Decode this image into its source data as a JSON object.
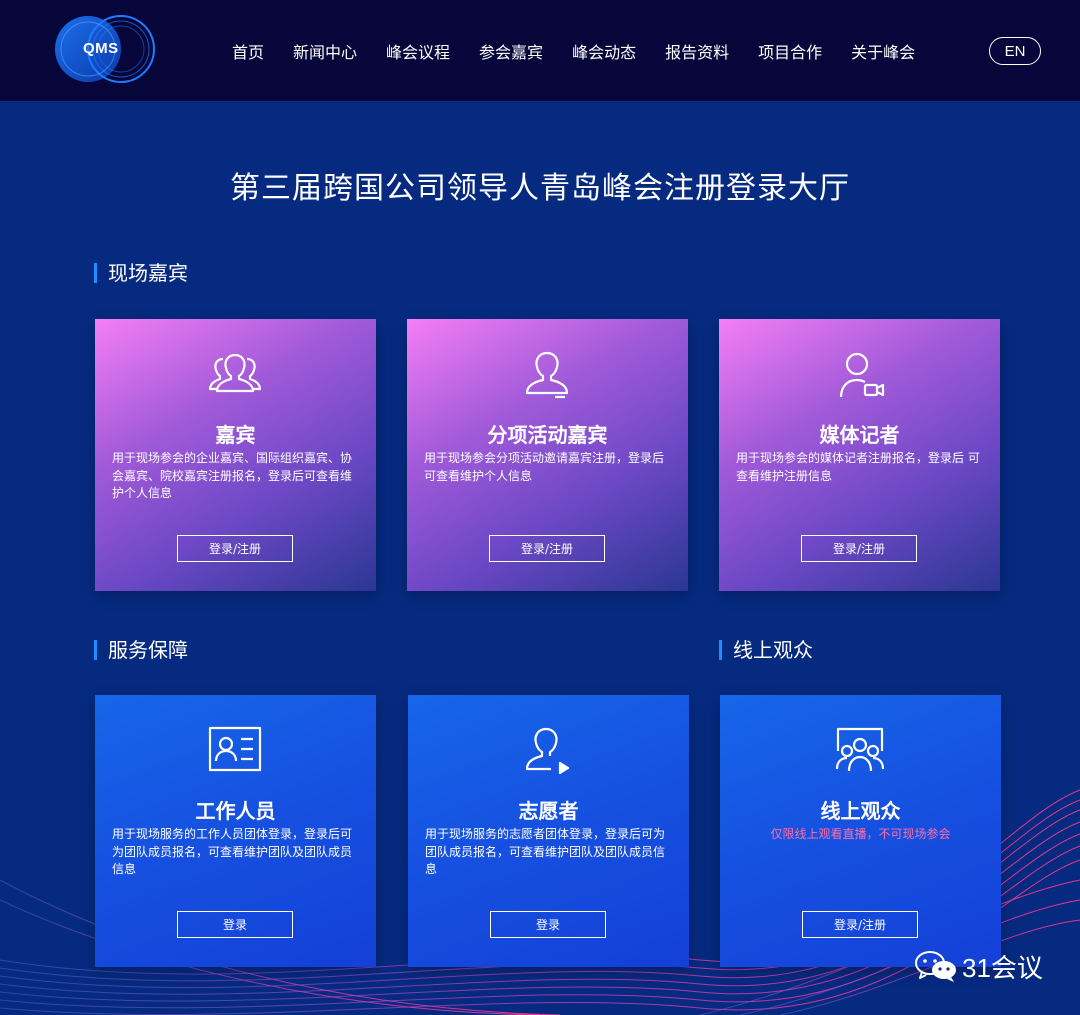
{
  "header": {
    "logo_text": "QMS",
    "nav": [
      "首页",
      "新闻中心",
      "峰会议程",
      "参会嘉宾",
      "峰会动态",
      "报告资料",
      "项目合作",
      "关于峰会"
    ],
    "lang_label": "EN"
  },
  "page_title": "第三届跨国公司领导人青岛峰会注册登录大厅",
  "sections": {
    "onsite": "现场嘉宾",
    "service": "服务保障",
    "online": "线上观众"
  },
  "cards": {
    "guest": {
      "title": "嘉宾",
      "desc": "用于现场参会的企业嘉宾、国际组织嘉宾、协会嘉宾、院校嘉宾注册报名，登录后可查看维护个人信息",
      "button": "登录/注册",
      "icon": "group-users-icon"
    },
    "sub_guest": {
      "title": "分项活动嘉宾",
      "desc": "用于现场参会分项活动邀请嘉宾注册，登录后可查看维护个人信息",
      "button": "登录/注册",
      "icon": "user-icon"
    },
    "media": {
      "title": "媒体记者",
      "desc": "用于现场参会的媒体记者注册报名，登录后 可查看维护注册信息",
      "button": "登录/注册",
      "icon": "user-camera-icon"
    },
    "staff": {
      "title": "工作人员",
      "desc": "用于现场服务的工作人员团体登录，登录后可为团队成员报名，可查看维护团队及团队成员信息",
      "button": "登录",
      "icon": "id-card-icon"
    },
    "volunteer": {
      "title": "志愿者",
      "desc": "用于现场服务的志愿者团体登录，登录后可为团队成员报名，可查看维护团队及团队成员信息",
      "button": "登录",
      "icon": "user-play-icon"
    },
    "online": {
      "title": "线上观众",
      "note": "仅限线上观看直播，不可现场参会",
      "button": "登录/注册",
      "icon": "audience-screen-icon"
    }
  },
  "watermark": "31会议",
  "colors": {
    "header_bg": "#07063a",
    "page_bg": "#062a80",
    "accent": "#1e8fff",
    "note": "#ff6fa8"
  }
}
